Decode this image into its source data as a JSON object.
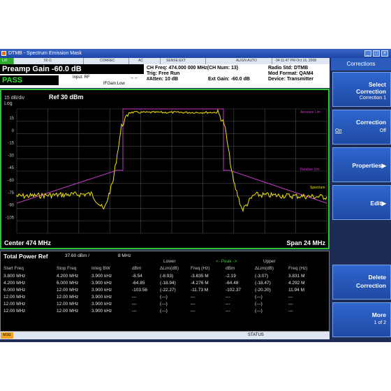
{
  "window": {
    "title": "DTMB - Spectrum Emission Mask",
    "buttons": [
      "_",
      "□",
      "×"
    ]
  },
  "status_strip": {
    "items": [
      "50 Ω",
      "CORREC",
      "AC",
      "SENSE:EXT",
      "ALIGN AUTO"
    ],
    "datetime": "04:11:47 PM Oct 16, 2008",
    "left_tag": "LXI"
  },
  "header": {
    "preamp": "Preamp Gain -60.0 dB",
    "pass": "PASS",
    "input": "Input: RF",
    "ifgain": "IFGain:Low",
    "ch_freq": "CH Freq: 474.000 000 MHz(CH Num: 13)",
    "trig": "Trig: Free Run",
    "atten": "#Atten: 10 dB",
    "ext_gain": "Ext Gain: -60.0 dB",
    "radio_std": "Radio Std: DTMB",
    "mod_format": "Mod Format: QAM4",
    "device": "Device: Transmitter"
  },
  "plot": {
    "scale": "15 dB/div",
    "ref": "Ref 30 dBm",
    "log": "Log",
    "y_ticks": [
      "15",
      "0",
      "-15",
      "-30",
      "-45",
      "-60",
      "-75",
      "-90",
      "-105"
    ],
    "center": "Center 474 MHz",
    "span": "Span 24 MHz",
    "trace_labels": [
      "Absolute Lim",
      "Relative Lim",
      "Spectrum"
    ],
    "colors": {
      "trace": "#f2e600",
      "limit": "#c23ac2",
      "grid": "#555555",
      "border": "#2fc42f"
    }
  },
  "table": {
    "title": "Total Power Ref",
    "ref_value": "37.60 dBm /",
    "ref_bw": "8 MHz",
    "group_lower": "Lower",
    "group_peak": "<- Peak ->",
    "group_upper": "Upper",
    "headers": [
      "Start Freq",
      "Stop Freq",
      "Integ BW",
      "dBm",
      "ΔLim(dB)",
      "Freq (Hz)",
      "dBm",
      "ΔLim(dB)",
      "Freq (Hz)"
    ],
    "rows": [
      [
        "3.800 MHz",
        "4.200 MHz",
        "3.900 kHz",
        "-8.54",
        "(-8.93)",
        "-3.835 M",
        "-2.19",
        "(-3.07)",
        "3.831 M"
      ],
      [
        "4.200 MHz",
        "6.000 MHz",
        "3.900 kHz",
        "-64.85",
        "(-18.94)",
        "-4.276 M",
        "-64.48",
        "(-18.47)",
        "4.292 M"
      ],
      [
        "6.000 MHz",
        "12.00 MHz",
        "3.900 kHz",
        "-103.56",
        "(-22.27)",
        "-11.73 M",
        "-102.37",
        "(-20.20)",
        "11.94 M"
      ],
      [
        "12.00 MHz",
        "12.00 MHz",
        "3.900 kHz",
        "---",
        "(---)",
        "---",
        "---",
        "(---)",
        "---"
      ],
      [
        "12.00 MHz",
        "12.00 MHz",
        "3.900 kHz",
        "---",
        "(---)",
        "---",
        "---",
        "(---)",
        "---"
      ],
      [
        "12.00 MHz",
        "12.00 MHz",
        "3.900 kHz",
        "---",
        "(---)",
        "---",
        "---",
        "(---)",
        "---"
      ]
    ]
  },
  "bottom": {
    "msg": "MSG",
    "status": "STATUS"
  },
  "softkeys": {
    "title": "Corrections",
    "keys": [
      {
        "main1": "Select",
        "main2": "Correction",
        "sub": "Correction 1"
      },
      {
        "main1": "Correction",
        "left": "On",
        "sub": "Off"
      },
      {
        "main1": "Properties▶"
      },
      {
        "main1": "Edit▶"
      },
      {
        "main1": "Delete",
        "main2": "Correction"
      },
      {
        "main1": "More",
        "sub": "1 of 2"
      }
    ]
  }
}
